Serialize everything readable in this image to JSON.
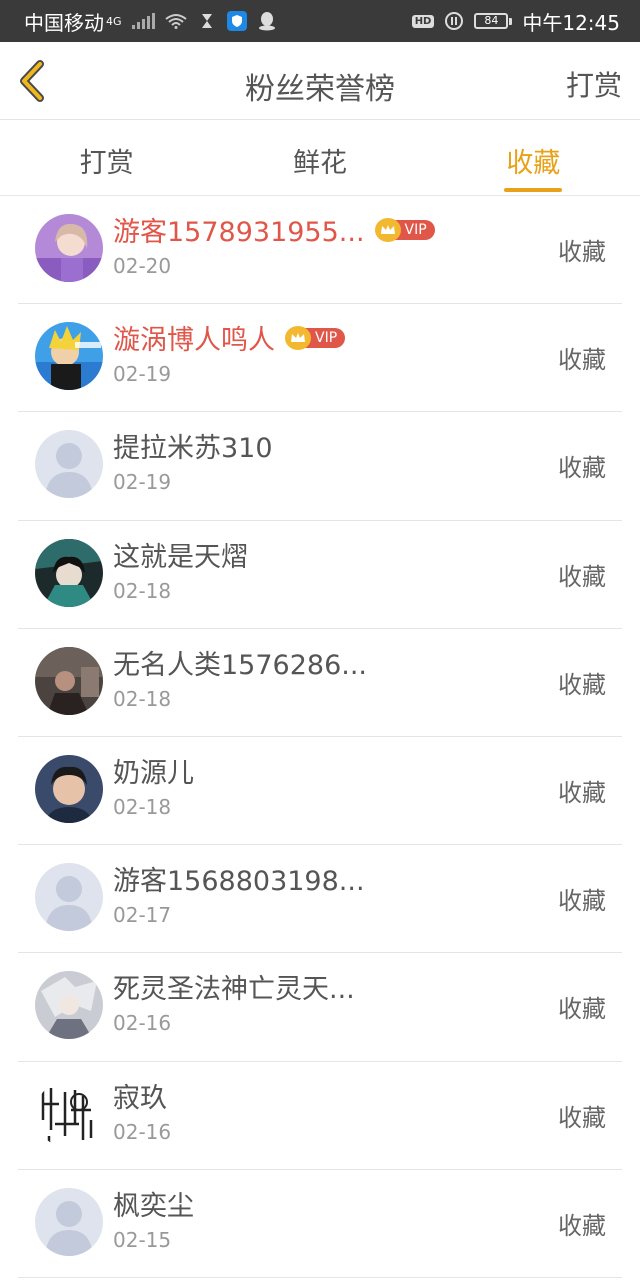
{
  "status_bar": {
    "carrier": "中国移动",
    "network": "4G",
    "hd": "HD",
    "battery": "84",
    "time": "中午12:45"
  },
  "header": {
    "title": "粉丝荣誉榜",
    "action": "打赏",
    "back_icon": "chevron-left-icon"
  },
  "tabs": [
    {
      "label": "打赏",
      "active": false
    },
    {
      "label": "鲜花",
      "active": false
    },
    {
      "label": "收藏",
      "active": true
    }
  ],
  "colors": {
    "accent": "#e8a21a",
    "vip_name": "#e0574a",
    "vip_tag": "#e0574a",
    "crown": "#f2b830"
  },
  "vip_label": "VIP",
  "list": [
    {
      "name": "游客1578931955...",
      "date": "02-20",
      "type": "收藏",
      "vip": true,
      "avatar": "photo-purple"
    },
    {
      "name": "漩涡博人鸣人",
      "date": "02-19",
      "type": "收藏",
      "vip": true,
      "avatar": "anime-blue"
    },
    {
      "name": "提拉米苏310",
      "date": "02-19",
      "type": "收藏",
      "vip": false,
      "avatar": "default"
    },
    {
      "name": "这就是天熠",
      "date": "02-18",
      "type": "收藏",
      "vip": false,
      "avatar": "anime-dark"
    },
    {
      "name": "无名人类1576286...",
      "date": "02-18",
      "type": "收藏",
      "vip": false,
      "avatar": "photo-dim"
    },
    {
      "name": "奶源儿",
      "date": "02-18",
      "type": "收藏",
      "vip": false,
      "avatar": "photo-boy"
    },
    {
      "name": "游客1568803198...",
      "date": "02-17",
      "type": "收藏",
      "vip": false,
      "avatar": "default"
    },
    {
      "name": "死灵圣法神亡灵天...",
      "date": "02-16",
      "type": "收藏",
      "vip": false,
      "avatar": "anime-grey"
    },
    {
      "name": "寂玖",
      "date": "02-16",
      "type": "收藏",
      "vip": false,
      "avatar": "sketch"
    },
    {
      "name": "枫奕尘",
      "date": "02-15",
      "type": "收藏",
      "vip": false,
      "avatar": "default"
    }
  ]
}
